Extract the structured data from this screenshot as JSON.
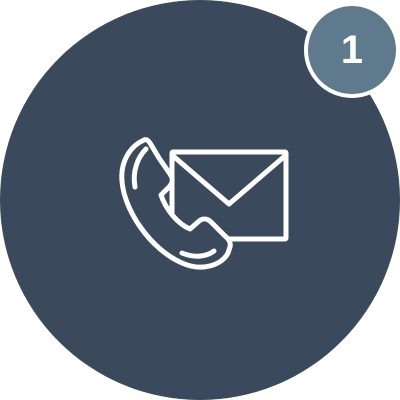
{
  "contact_button": {
    "icon": "phone-mail-icon",
    "background_color": "#3a4a5c",
    "icon_color": "#ffffff"
  },
  "notification_badge": {
    "count": "1",
    "background_color": "#5f7a8c"
  }
}
